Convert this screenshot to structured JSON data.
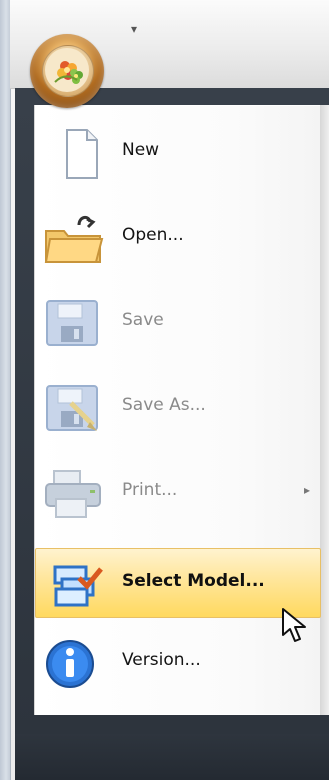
{
  "app": {
    "menu_items": [
      {
        "label": "New",
        "icon": "new-document-icon",
        "state": "enabled"
      },
      {
        "label": "Open...",
        "icon": "open-folder-icon",
        "state": "enabled"
      },
      {
        "label": "Save",
        "icon": "save-disk-icon",
        "state": "disabled"
      },
      {
        "label": "Save As...",
        "icon": "save-as-icon",
        "state": "disabled"
      },
      {
        "label": "Print...",
        "icon": "printer-icon",
        "state": "disabled",
        "submenu": "▸"
      },
      {
        "label": "Select Model...",
        "icon": "select-model-icon",
        "state": "selected"
      },
      {
        "label": "Version...",
        "icon": "info-icon",
        "state": "enabled"
      }
    ],
    "quick_access_arrow": "▾"
  }
}
